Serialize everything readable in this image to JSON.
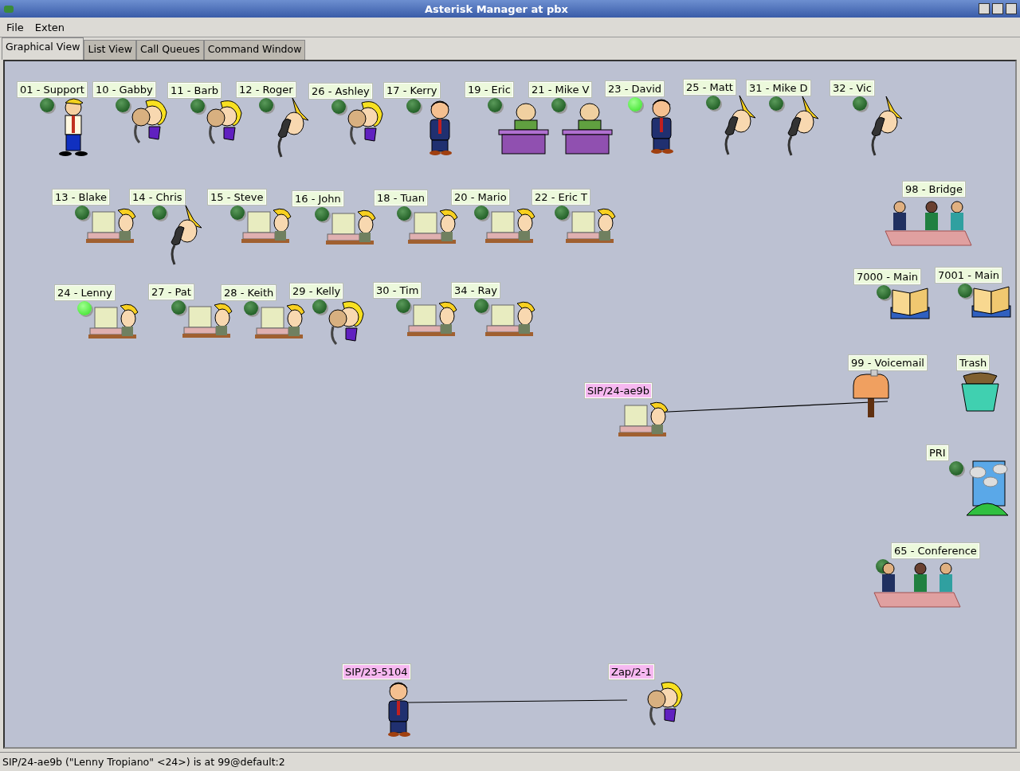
{
  "window": {
    "title": "Asterisk Manager at pbx"
  },
  "menu": [
    "File",
    "Exten"
  ],
  "tabs": [
    {
      "label": "Graphical View",
      "selected": true
    },
    {
      "label": "List View",
      "selected": false
    },
    {
      "label": "Call Queues",
      "selected": false
    },
    {
      "label": "Command Window",
      "selected": false
    }
  ],
  "extensions": [
    {
      "label": "01 - Support",
      "kind": "standing",
      "lit": false
    },
    {
      "label": "10 - Gabby",
      "kind": "woman-phone",
      "lit": false
    },
    {
      "label": "11 - Barb",
      "kind": "woman-phone",
      "lit": false
    },
    {
      "label": "12 - Roger",
      "kind": "man-phone",
      "lit": false
    },
    {
      "label": "26 - Ashley",
      "kind": "woman-phone",
      "lit": false
    },
    {
      "label": "17 - Kerry",
      "kind": "suit",
      "lit": false
    },
    {
      "label": "19 - Eric",
      "kind": "desk",
      "lit": false
    },
    {
      "label": "21 - Mike V",
      "kind": "desk",
      "lit": false
    },
    {
      "label": "23 - David",
      "kind": "suit",
      "lit": true
    },
    {
      "label": "25 - Matt",
      "kind": "man-phone",
      "lit": false
    },
    {
      "label": "31 - Mike D",
      "kind": "man-phone",
      "lit": false
    },
    {
      "label": "32 - Vic",
      "kind": "man-phone",
      "lit": false
    },
    {
      "label": "13 - Blake",
      "kind": "computer",
      "lit": false
    },
    {
      "label": "14 - Chris",
      "kind": "man-phone",
      "lit": false
    },
    {
      "label": "15 - Steve",
      "kind": "computer",
      "lit": false
    },
    {
      "label": "16 - John",
      "kind": "computer",
      "lit": false
    },
    {
      "label": "18 - Tuan",
      "kind": "computer",
      "lit": false
    },
    {
      "label": "20 - Mario",
      "kind": "computer",
      "lit": false
    },
    {
      "label": "22 - Eric T",
      "kind": "computer",
      "lit": false
    },
    {
      "label": "98 - Bridge",
      "kind": "meeting"
    },
    {
      "label": "24 - Lenny",
      "kind": "computer",
      "lit": true
    },
    {
      "label": "27 - Pat",
      "kind": "computer",
      "lit": false
    },
    {
      "label": "28 - Keith",
      "kind": "computer",
      "lit": false
    },
    {
      "label": "29 - Kelly",
      "kind": "woman-phone",
      "lit": false
    },
    {
      "label": "30 - Tim",
      "kind": "computer",
      "lit": false
    },
    {
      "label": "34 - Ray",
      "kind": "computer",
      "lit": false
    },
    {
      "label": "7000 - Main",
      "kind": "folder",
      "lit": false
    },
    {
      "label": "7001 - Main",
      "kind": "folder",
      "lit": false
    },
    {
      "label": "99 - Voicemail",
      "kind": "mailbox"
    },
    {
      "label": "Trash",
      "kind": "trash"
    },
    {
      "label": "PRI",
      "kind": "pri",
      "lit": false
    },
    {
      "label": "65 - Conference",
      "kind": "meeting",
      "lit": false
    }
  ],
  "channels": [
    {
      "label": "SIP/24-ae9b",
      "kind": "computer",
      "connected": true
    },
    {
      "label": "SIP/23-5104",
      "kind": "suit",
      "connected": true
    },
    {
      "label": "Zap/2-1",
      "kind": "woman-phone",
      "connected": true
    }
  ],
  "status_bar": "SIP/24-ae9b (\"Lenny Tropiano\" <24>) is at 99@default:2"
}
